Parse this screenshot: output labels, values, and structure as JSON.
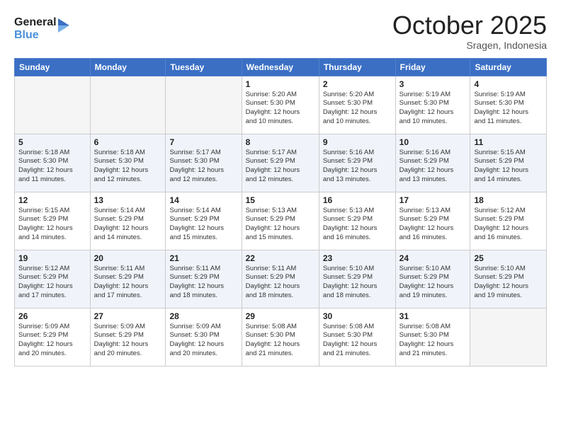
{
  "header": {
    "logo_line1": "General",
    "logo_line2": "Blue",
    "month": "October 2025",
    "location": "Sragen, Indonesia"
  },
  "weekdays": [
    "Sunday",
    "Monday",
    "Tuesday",
    "Wednesday",
    "Thursday",
    "Friday",
    "Saturday"
  ],
  "weeks": [
    [
      {
        "day": "",
        "info": ""
      },
      {
        "day": "",
        "info": ""
      },
      {
        "day": "",
        "info": ""
      },
      {
        "day": "1",
        "info": "Sunrise: 5:20 AM\nSunset: 5:30 PM\nDaylight: 12 hours\nand 10 minutes."
      },
      {
        "day": "2",
        "info": "Sunrise: 5:20 AM\nSunset: 5:30 PM\nDaylight: 12 hours\nand 10 minutes."
      },
      {
        "day": "3",
        "info": "Sunrise: 5:19 AM\nSunset: 5:30 PM\nDaylight: 12 hours\nand 10 minutes."
      },
      {
        "day": "4",
        "info": "Sunrise: 5:19 AM\nSunset: 5:30 PM\nDaylight: 12 hours\nand 11 minutes."
      }
    ],
    [
      {
        "day": "5",
        "info": "Sunrise: 5:18 AM\nSunset: 5:30 PM\nDaylight: 12 hours\nand 11 minutes."
      },
      {
        "day": "6",
        "info": "Sunrise: 5:18 AM\nSunset: 5:30 PM\nDaylight: 12 hours\nand 12 minutes."
      },
      {
        "day": "7",
        "info": "Sunrise: 5:17 AM\nSunset: 5:30 PM\nDaylight: 12 hours\nand 12 minutes."
      },
      {
        "day": "8",
        "info": "Sunrise: 5:17 AM\nSunset: 5:29 PM\nDaylight: 12 hours\nand 12 minutes."
      },
      {
        "day": "9",
        "info": "Sunrise: 5:16 AM\nSunset: 5:29 PM\nDaylight: 12 hours\nand 13 minutes."
      },
      {
        "day": "10",
        "info": "Sunrise: 5:16 AM\nSunset: 5:29 PM\nDaylight: 12 hours\nand 13 minutes."
      },
      {
        "day": "11",
        "info": "Sunrise: 5:15 AM\nSunset: 5:29 PM\nDaylight: 12 hours\nand 14 minutes."
      }
    ],
    [
      {
        "day": "12",
        "info": "Sunrise: 5:15 AM\nSunset: 5:29 PM\nDaylight: 12 hours\nand 14 minutes."
      },
      {
        "day": "13",
        "info": "Sunrise: 5:14 AM\nSunset: 5:29 PM\nDaylight: 12 hours\nand 14 minutes."
      },
      {
        "day": "14",
        "info": "Sunrise: 5:14 AM\nSunset: 5:29 PM\nDaylight: 12 hours\nand 15 minutes."
      },
      {
        "day": "15",
        "info": "Sunrise: 5:13 AM\nSunset: 5:29 PM\nDaylight: 12 hours\nand 15 minutes."
      },
      {
        "day": "16",
        "info": "Sunrise: 5:13 AM\nSunset: 5:29 PM\nDaylight: 12 hours\nand 16 minutes."
      },
      {
        "day": "17",
        "info": "Sunrise: 5:13 AM\nSunset: 5:29 PM\nDaylight: 12 hours\nand 16 minutes."
      },
      {
        "day": "18",
        "info": "Sunrise: 5:12 AM\nSunset: 5:29 PM\nDaylight: 12 hours\nand 16 minutes."
      }
    ],
    [
      {
        "day": "19",
        "info": "Sunrise: 5:12 AM\nSunset: 5:29 PM\nDaylight: 12 hours\nand 17 minutes."
      },
      {
        "day": "20",
        "info": "Sunrise: 5:11 AM\nSunset: 5:29 PM\nDaylight: 12 hours\nand 17 minutes."
      },
      {
        "day": "21",
        "info": "Sunrise: 5:11 AM\nSunset: 5:29 PM\nDaylight: 12 hours\nand 18 minutes."
      },
      {
        "day": "22",
        "info": "Sunrise: 5:11 AM\nSunset: 5:29 PM\nDaylight: 12 hours\nand 18 minutes."
      },
      {
        "day": "23",
        "info": "Sunrise: 5:10 AM\nSunset: 5:29 PM\nDaylight: 12 hours\nand 18 minutes."
      },
      {
        "day": "24",
        "info": "Sunrise: 5:10 AM\nSunset: 5:29 PM\nDaylight: 12 hours\nand 19 minutes."
      },
      {
        "day": "25",
        "info": "Sunrise: 5:10 AM\nSunset: 5:29 PM\nDaylight: 12 hours\nand 19 minutes."
      }
    ],
    [
      {
        "day": "26",
        "info": "Sunrise: 5:09 AM\nSunset: 5:29 PM\nDaylight: 12 hours\nand 20 minutes."
      },
      {
        "day": "27",
        "info": "Sunrise: 5:09 AM\nSunset: 5:29 PM\nDaylight: 12 hours\nand 20 minutes."
      },
      {
        "day": "28",
        "info": "Sunrise: 5:09 AM\nSunset: 5:30 PM\nDaylight: 12 hours\nand 20 minutes."
      },
      {
        "day": "29",
        "info": "Sunrise: 5:08 AM\nSunset: 5:30 PM\nDaylight: 12 hours\nand 21 minutes."
      },
      {
        "day": "30",
        "info": "Sunrise: 5:08 AM\nSunset: 5:30 PM\nDaylight: 12 hours\nand 21 minutes."
      },
      {
        "day": "31",
        "info": "Sunrise: 5:08 AM\nSunset: 5:30 PM\nDaylight: 12 hours\nand 21 minutes."
      },
      {
        "day": "",
        "info": ""
      }
    ]
  ]
}
